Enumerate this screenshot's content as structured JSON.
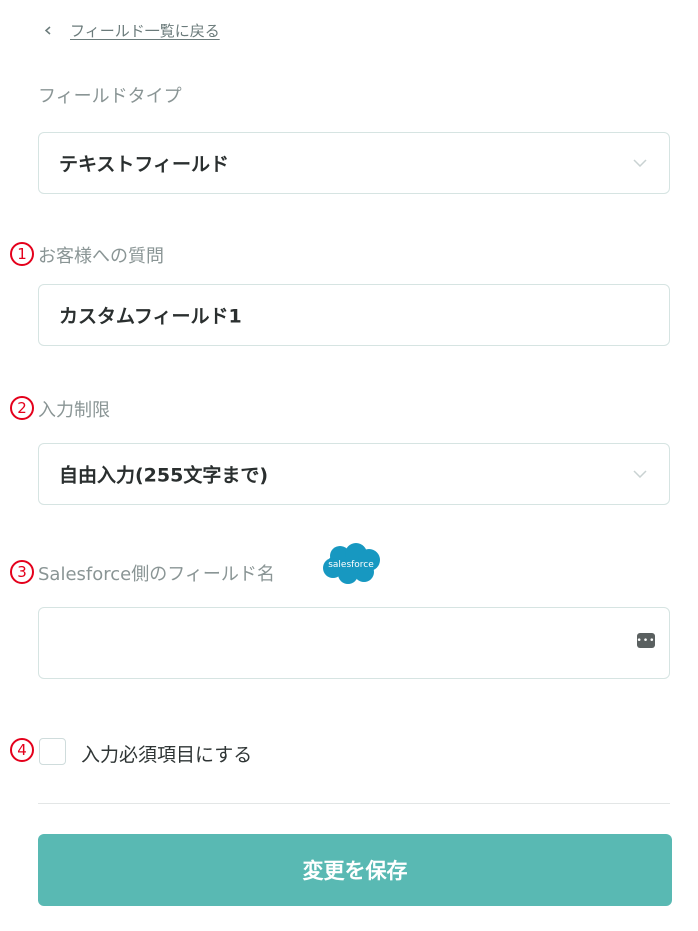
{
  "back_link": {
    "label": "フィールド一覧に戻る"
  },
  "field_type": {
    "label": "フィールドタイプ",
    "value": "テキストフィールド"
  },
  "question": {
    "marker": "1",
    "label": "お客様への質問",
    "value": "カスタムフィールド1"
  },
  "restriction": {
    "marker": "2",
    "label": "入力制限",
    "value": "自由入力(255文字まで)"
  },
  "salesforce_field": {
    "marker": "3",
    "label": "Salesforce側のフィールド名",
    "logo_text": "salesforce",
    "value": ""
  },
  "required": {
    "marker": "4",
    "label": "入力必須項目にする",
    "checked": false
  },
  "save_button": {
    "label": "変更を保存"
  },
  "colors": {
    "accent": "#59b9b3",
    "marker": "#e4001b",
    "salesforce": "#1798c1"
  }
}
